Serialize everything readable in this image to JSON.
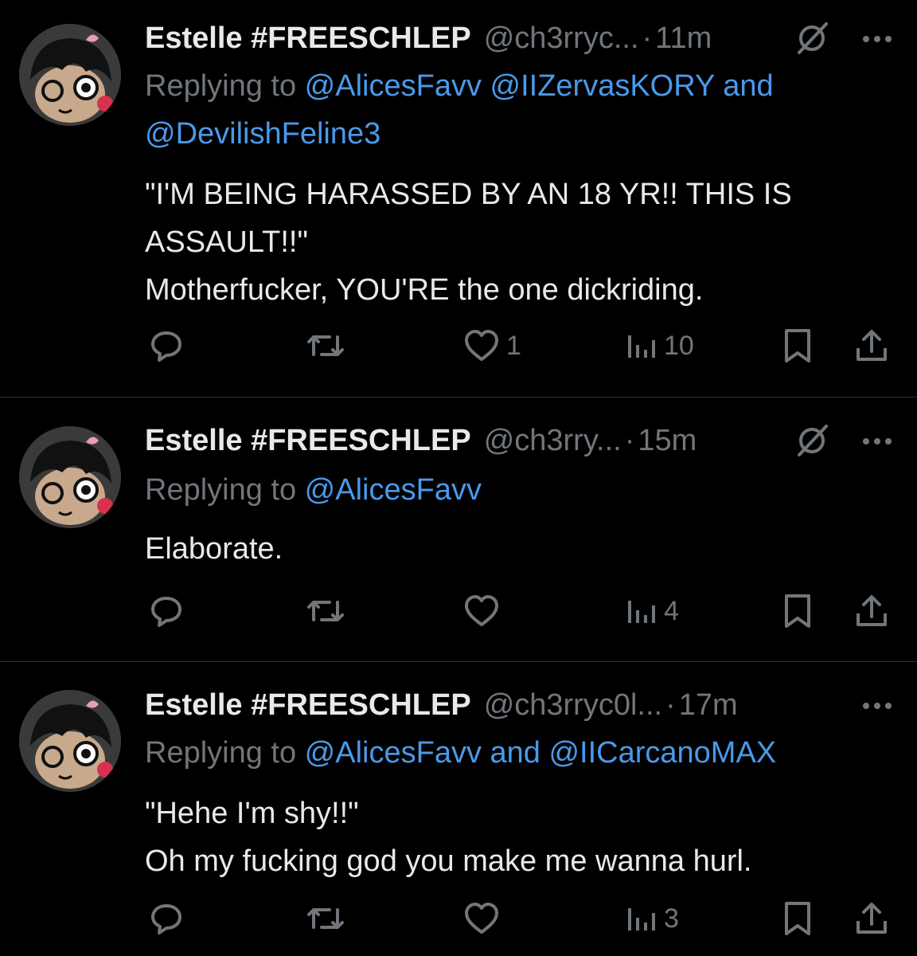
{
  "colors": {
    "background": "#000000",
    "text": "#e7e9ea",
    "muted": "#71767b",
    "link": "#4a99e9",
    "divider": "#2f3336"
  },
  "tweets": [
    {
      "display_name": "Estelle #FREESCHLEP",
      "handle": "@ch3rryc...",
      "dot": "·",
      "time": "11m",
      "replying_prefix": "Replying to ",
      "mentions_line1": "@AlicesFavv @IIZervasKORY and",
      "mentions_line2": "@DevilishFeline3",
      "text": "\"I'M BEING HARASSED BY AN 18 YR!! THIS IS\nASSAULT!!\"\nMotherfucker, YOU'RE the one dickriding.",
      "likes": "1",
      "views": "10",
      "icons": [
        "reply-icon",
        "retweet-icon",
        "like-icon",
        "views-icon",
        "bookmark-icon",
        "share-icon",
        "grok-icon",
        "more-icon"
      ]
    },
    {
      "display_name": "Estelle #FREESCHLEP",
      "handle": "@ch3rry...",
      "dot": "·",
      "time": "15m",
      "replying_prefix": "Replying to ",
      "mentions_line1": "@AlicesFavv",
      "text": "Elaborate.",
      "likes": "",
      "views": "4"
    },
    {
      "display_name": "Estelle #FREESCHLEP",
      "handle": "@ch3rryc0l...",
      "dot": "·",
      "time": "17m",
      "replying_prefix": "Replying to ",
      "mentions_line1": "@AlicesFavv and @IICarcanoMAX",
      "text": "\"Hehe I'm shy!!\"\nOh my fucking god you make me wanna hurl.",
      "likes": "",
      "views": "3"
    }
  ]
}
